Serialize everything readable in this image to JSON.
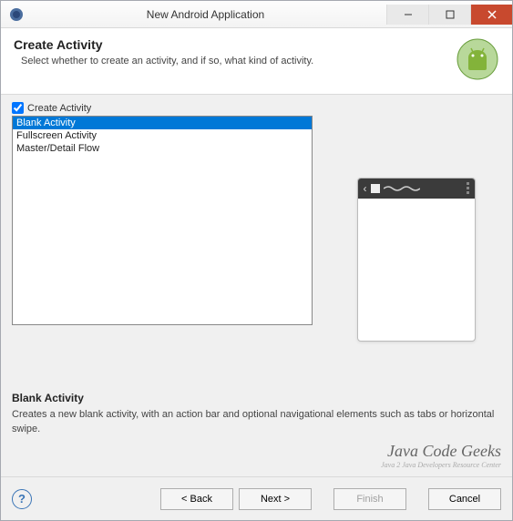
{
  "titlebar": {
    "title": "New Android Application"
  },
  "header": {
    "title": "Create Activity",
    "subtitle": "Select whether to create an activity, and if so, what kind of activity."
  },
  "content": {
    "checkbox_label": "Create Activity",
    "list_items": [
      "Blank Activity",
      "Fullscreen Activity",
      "Master/Detail Flow"
    ]
  },
  "description": {
    "title": "Blank Activity",
    "text": "Creates a new blank activity, with an action bar and optional navigational elements such as tabs or horizontal swipe."
  },
  "watermark": {
    "text": "Java Code Geeks",
    "sub": "Java 2 Java Developers Resource Center"
  },
  "footer": {
    "back": "< Back",
    "next": "Next >",
    "finish": "Finish",
    "cancel": "Cancel"
  }
}
